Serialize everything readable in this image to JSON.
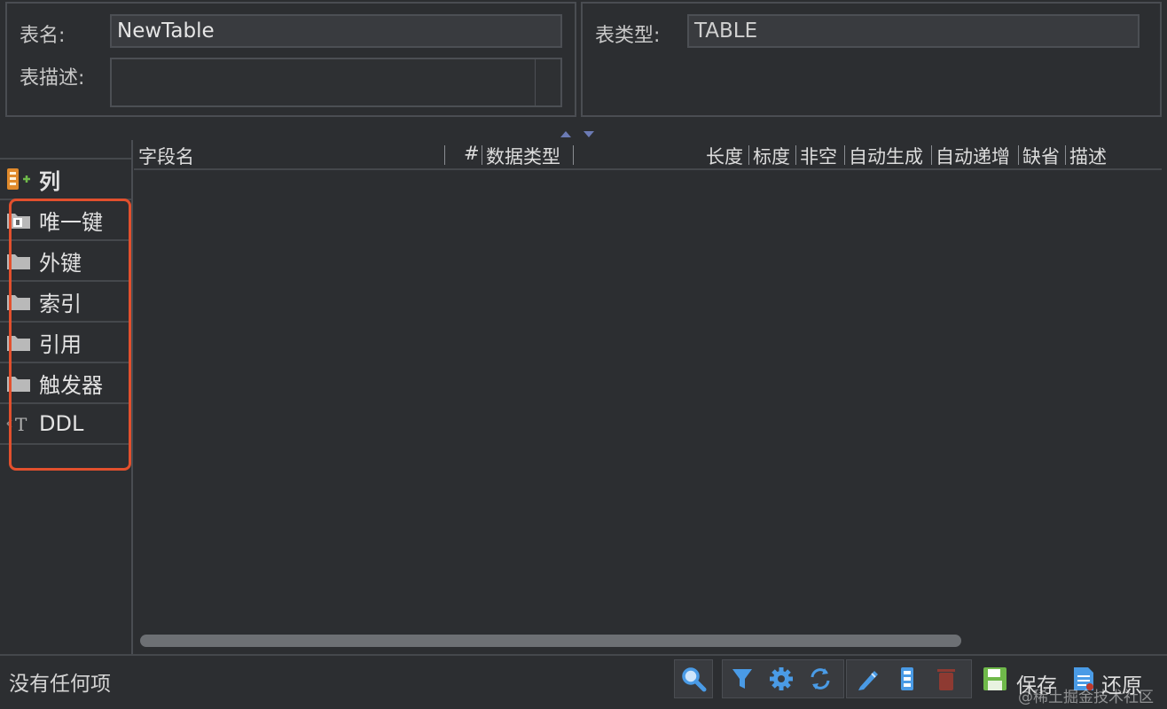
{
  "props": {
    "table_name_label": "表名:",
    "table_name_value": "NewTable",
    "table_desc_label": "表描述:",
    "table_desc_value": "",
    "table_type_label": "表类型:",
    "table_type_value": "TABLE"
  },
  "tree": {
    "items": [
      {
        "label": "列",
        "icon": "columns-add-icon"
      },
      {
        "label": "唯一键",
        "icon": "unique-key-icon"
      },
      {
        "label": "外键",
        "icon": "folder-icon"
      },
      {
        "label": "索引",
        "icon": "folder-icon"
      },
      {
        "label": "引用",
        "icon": "folder-icon"
      },
      {
        "label": "触发器",
        "icon": "folder-icon"
      },
      {
        "label": "DDL",
        "icon": "ddl-icon"
      }
    ]
  },
  "grid": {
    "columns": [
      "字段名",
      "#",
      "数据类型",
      "长度",
      "标度",
      "非空",
      "自动生成",
      "自动递增",
      "缺省",
      "描述"
    ]
  },
  "status": {
    "text": "没有任何项",
    "save_label": "保存",
    "revert_label": "还原"
  },
  "watermark": "@稀土掘金技术社区",
  "colors": {
    "highlight_box": "#e2502d",
    "icon_blue": "#4a9be6",
    "icon_green": "#6fb94a",
    "icon_red": "#c0392b",
    "background": "#2c2e31"
  }
}
